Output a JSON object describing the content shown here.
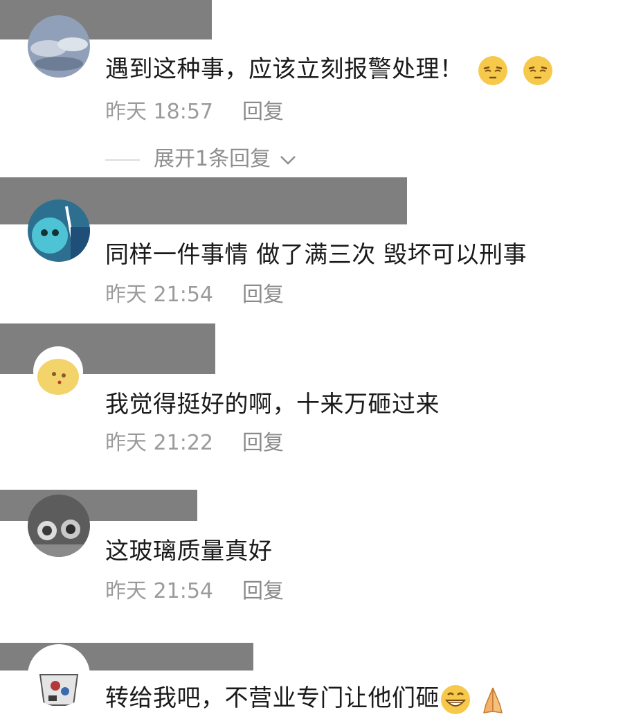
{
  "comments": [
    {
      "text": "遇到这种事，应该立刻报警处理！",
      "time": "昨天 18:57",
      "reply_label": "回复",
      "emojis": [
        "squint-annoyed-emoji",
        "squint-annoyed-emoji"
      ]
    },
    {
      "text": "同样一件事情 做了满三次 毁坏可以刑事",
      "time": "昨天 21:54",
      "reply_label": "回复"
    },
    {
      "text": "我觉得挺好的啊，十来万砸过来",
      "time": "昨天 21:22",
      "reply_label": "回复"
    },
    {
      "text": "这玻璃质量真好",
      "time": "昨天 21:54",
      "reply_label": "回复"
    },
    {
      "text": "转给我吧，不营业专门让他们砸",
      "emojis": [
        "grin-emoji",
        "pray-emoji"
      ]
    }
  ],
  "expand_replies": "展开1条回复",
  "colors": {
    "redaction": "#7f7f7f",
    "meta_text": "#9b9b9b",
    "comment_text": "#1a1a1a"
  }
}
